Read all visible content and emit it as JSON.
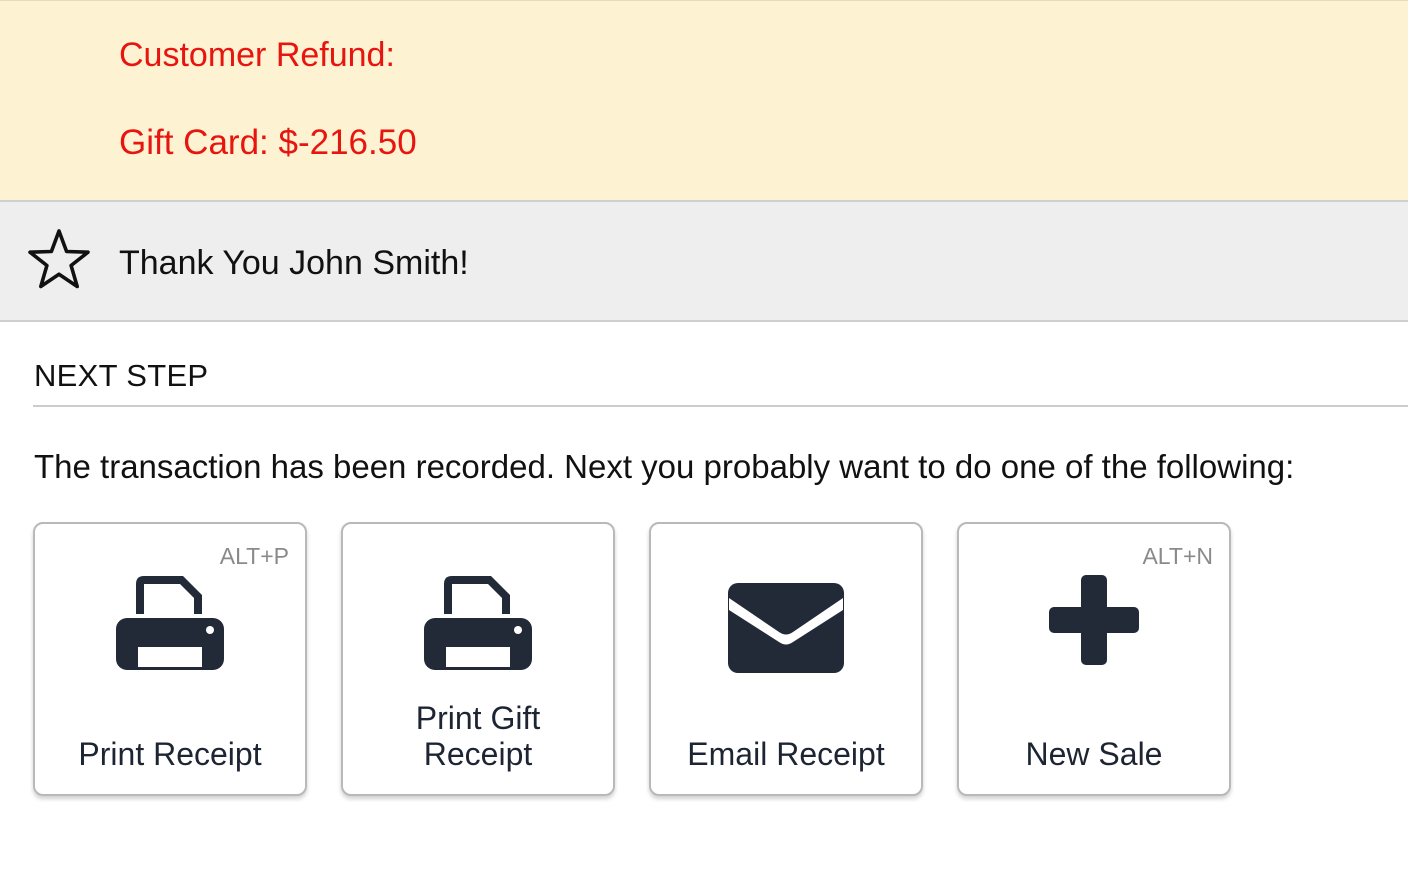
{
  "refund": {
    "title": "Customer Refund:",
    "line": "Gift Card: $-216.50",
    "color": "#e8140f",
    "background": "#fdf3d2"
  },
  "thanks": {
    "icon": "star-outline-icon",
    "text": "Thank You John Smith!"
  },
  "next_step": {
    "heading": "NEXT STEP",
    "intro": "The transaction has been recorded. Next you probably want to do one of the following:"
  },
  "actions": [
    {
      "label": "Print Receipt",
      "shortcut": "ALT+P",
      "icon": "printer-icon"
    },
    {
      "label": "Print Gift Receipt",
      "shortcut": "",
      "icon": "printer-icon"
    },
    {
      "label": "Email Receipt",
      "shortcut": "",
      "icon": "envelope-icon"
    },
    {
      "label": "New Sale",
      "shortcut": "ALT+N",
      "icon": "plus-icon"
    }
  ],
  "colors": {
    "icon": "#222a38",
    "tile_border": "#b9b9b9"
  }
}
